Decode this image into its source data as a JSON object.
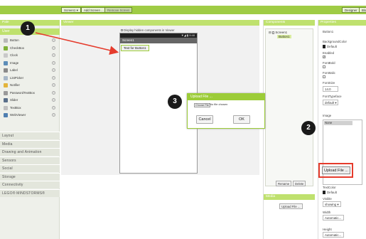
{
  "caption_fragment": "...",
  "toolbar": {
    "screen_select": "Screen1 ▾",
    "add_screen": "Add Screen ...",
    "remove_screen": "Remove Screen",
    "designer": "Designer",
    "blocks": "Blo"
  },
  "palette": {
    "header": "Pale",
    "user_interface": "User",
    "items": [
      {
        "label": "Button",
        "icon": "button-icon",
        "color": "#b8b8b8"
      },
      {
        "label": "CheckBox",
        "icon": "checkbox-icon",
        "color": "#7fb13a"
      },
      {
        "label": "Clock",
        "icon": "clock-icon",
        "color": "#c9c9c9"
      },
      {
        "label": "Image",
        "icon": "image-icon",
        "color": "#5d8db8"
      },
      {
        "label": "Label",
        "icon": "label-icon",
        "color": "#8a8a8a"
      },
      {
        "label": "ListPicker",
        "icon": "listpicker-icon",
        "color": "#a8b8c8"
      },
      {
        "label": "Notifier",
        "icon": "notifier-icon",
        "color": "#e3b43a"
      },
      {
        "label": "PasswordTextBox",
        "icon": "password-icon",
        "color": "#9a9a9a"
      },
      {
        "label": "Slider",
        "icon": "slider-icon",
        "color": "#5a6f8a"
      },
      {
        "label": "TextBox",
        "icon": "textbox-icon",
        "color": "#c0c0c0"
      },
      {
        "label": "WebViewer",
        "icon": "webviewer-icon",
        "color": "#4f7fb0"
      }
    ],
    "categories": [
      "Layout",
      "Media",
      "Drawing and Animation",
      "Sensors",
      "Social",
      "Storage",
      "Connectivity",
      "LEGO® MINDSTORMS®"
    ]
  },
  "viewer": {
    "header": "Viewer",
    "hidden_checkbox": "Display hidden components in Viewer",
    "status_time": "▼◢ ▮ 9:48",
    "screen_title": "Screen1",
    "button_text": "Text for Button1"
  },
  "components": {
    "header": "Components",
    "tree_toggle": "⊟",
    "screen": "Screen1",
    "button": "Button1",
    "rename": "Rename",
    "delete": "Delete",
    "media_header": "Media",
    "upload": "Upload File ..."
  },
  "properties": {
    "header": "Properties",
    "component": "Button1",
    "background_color_label": "BackgroundColor",
    "background_color_value": "Default",
    "enabled_label": "Enabled",
    "enabled_checked": "✓",
    "font_bold_label": "FontBold",
    "font_italic_label": "FontItalic",
    "font_size_label": "FontSize",
    "font_size_value": "14.0",
    "font_typeface_label": "FontTypeface",
    "font_typeface_value": "default ▾",
    "image_label": "Image",
    "image_value": "None",
    "upload": "Upload File ...",
    "text_color_label": "TextColor",
    "text_color_value": "Default",
    "visible_label": "Visible",
    "visible_value": "showing ▾",
    "width_label": "Width",
    "width_value": "Automatic...",
    "height_label": "Height",
    "height_value": "Automatic..."
  },
  "dialog": {
    "title": "Upload File ...",
    "choose": "Choose File",
    "no_file": "No file chosen",
    "cancel": "Cancel",
    "ok": "OK"
  },
  "markers": [
    "1",
    "2",
    "3"
  ],
  "colors": {
    "accent": "#9fcc45",
    "header": "#bfe16e",
    "highlight": "#e53b2c"
  }
}
